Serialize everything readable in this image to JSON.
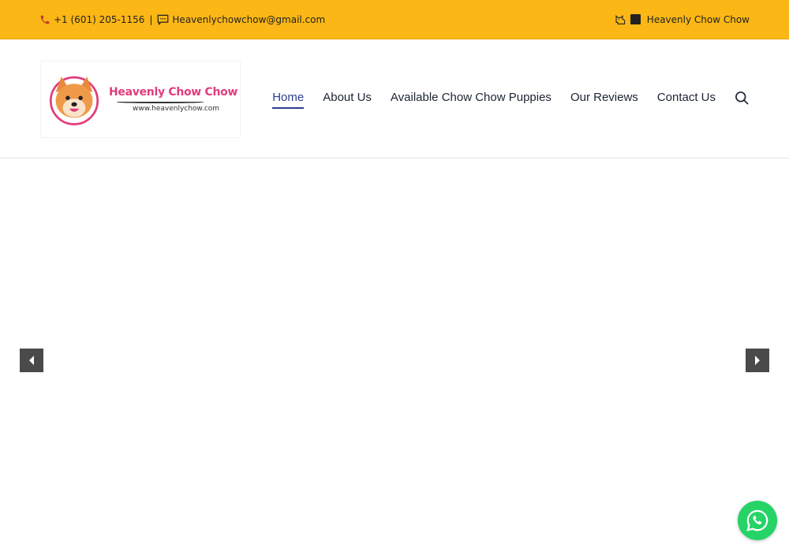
{
  "topbar": {
    "phone": "+1 (601) 205-1156",
    "separator": "|",
    "email": "Heavenlychowchow@gmail.com",
    "brand": "Heavenly Chow Chow",
    "background": "#fbb715"
  },
  "logo": {
    "name": "Heavenly Chow Chow",
    "url": "www.heavenlychow.com"
  },
  "nav": {
    "items": [
      {
        "label": "Home",
        "active": true
      },
      {
        "label": "About Us",
        "active": false
      },
      {
        "label": "Available Chow Chow Puppies",
        "active": false
      },
      {
        "label": "Our Reviews",
        "active": false
      },
      {
        "label": "Contact Us",
        "active": false
      }
    ],
    "active_color": "#2e3e8f"
  },
  "icons": {
    "phone": "phone-icon",
    "email": "chat-bubble-icon",
    "brand": "dog-icon",
    "search": "search-icon",
    "prev": "chevron-left-icon",
    "next": "chevron-right-icon",
    "whatsapp": "whatsapp-icon"
  }
}
